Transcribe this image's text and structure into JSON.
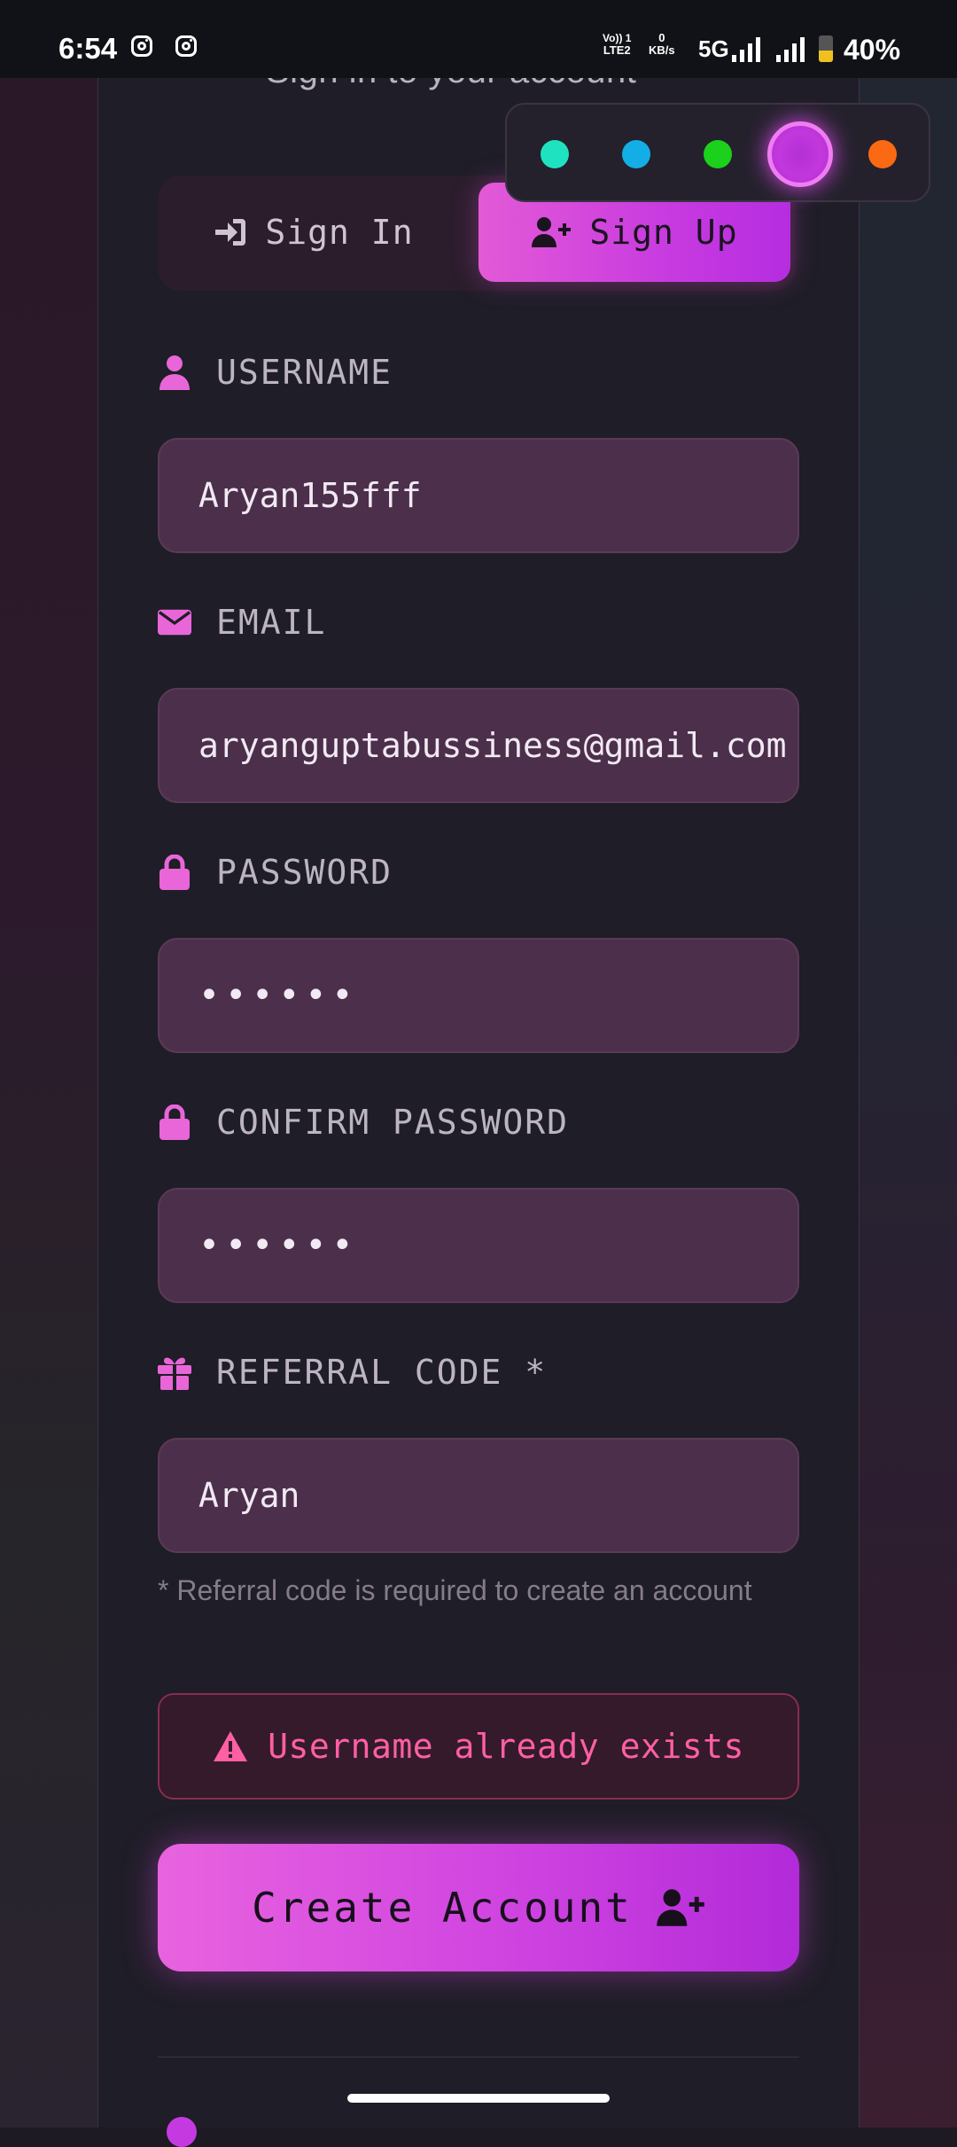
{
  "status_bar": {
    "time": "6:54",
    "net_top": "Vo)) 1",
    "net_bottom": "LTE2",
    "speed_top": "0",
    "speed_bottom": "KB/s",
    "network": "5G",
    "battery": "40%"
  },
  "header": {
    "subtitle": "Sign in to your account"
  },
  "theme_picker": {
    "colors": [
      "#1fe3c0",
      "#13aee6",
      "#1bd11b",
      "#c238dc",
      "#fb6a12"
    ],
    "selected": "#c238dc"
  },
  "tabs": {
    "sign_in": "Sign In",
    "sign_up": "Sign Up",
    "active": "Sign Up"
  },
  "form": {
    "username_label": "USERNAME",
    "username_value": "Aryan155fff",
    "email_label": "EMAIL",
    "email_value": "aryanguptabussiness@gmail.com",
    "password_label": "PASSWORD",
    "password_value": "••••••",
    "confirm_label": "CONFIRM PASSWORD",
    "confirm_value": "••••••",
    "referral_label": "REFERRAL CODE *",
    "referral_value": "Aryan",
    "referral_hint": "* Referral code is required to create an account"
  },
  "error": {
    "message": "Username already exists"
  },
  "actions": {
    "create_label": "Create Account"
  },
  "colors": {
    "accent": "#d24ae0",
    "icon": "#e866d8",
    "error": "#ff5fa4",
    "field_bg": "#4c2f4b"
  }
}
